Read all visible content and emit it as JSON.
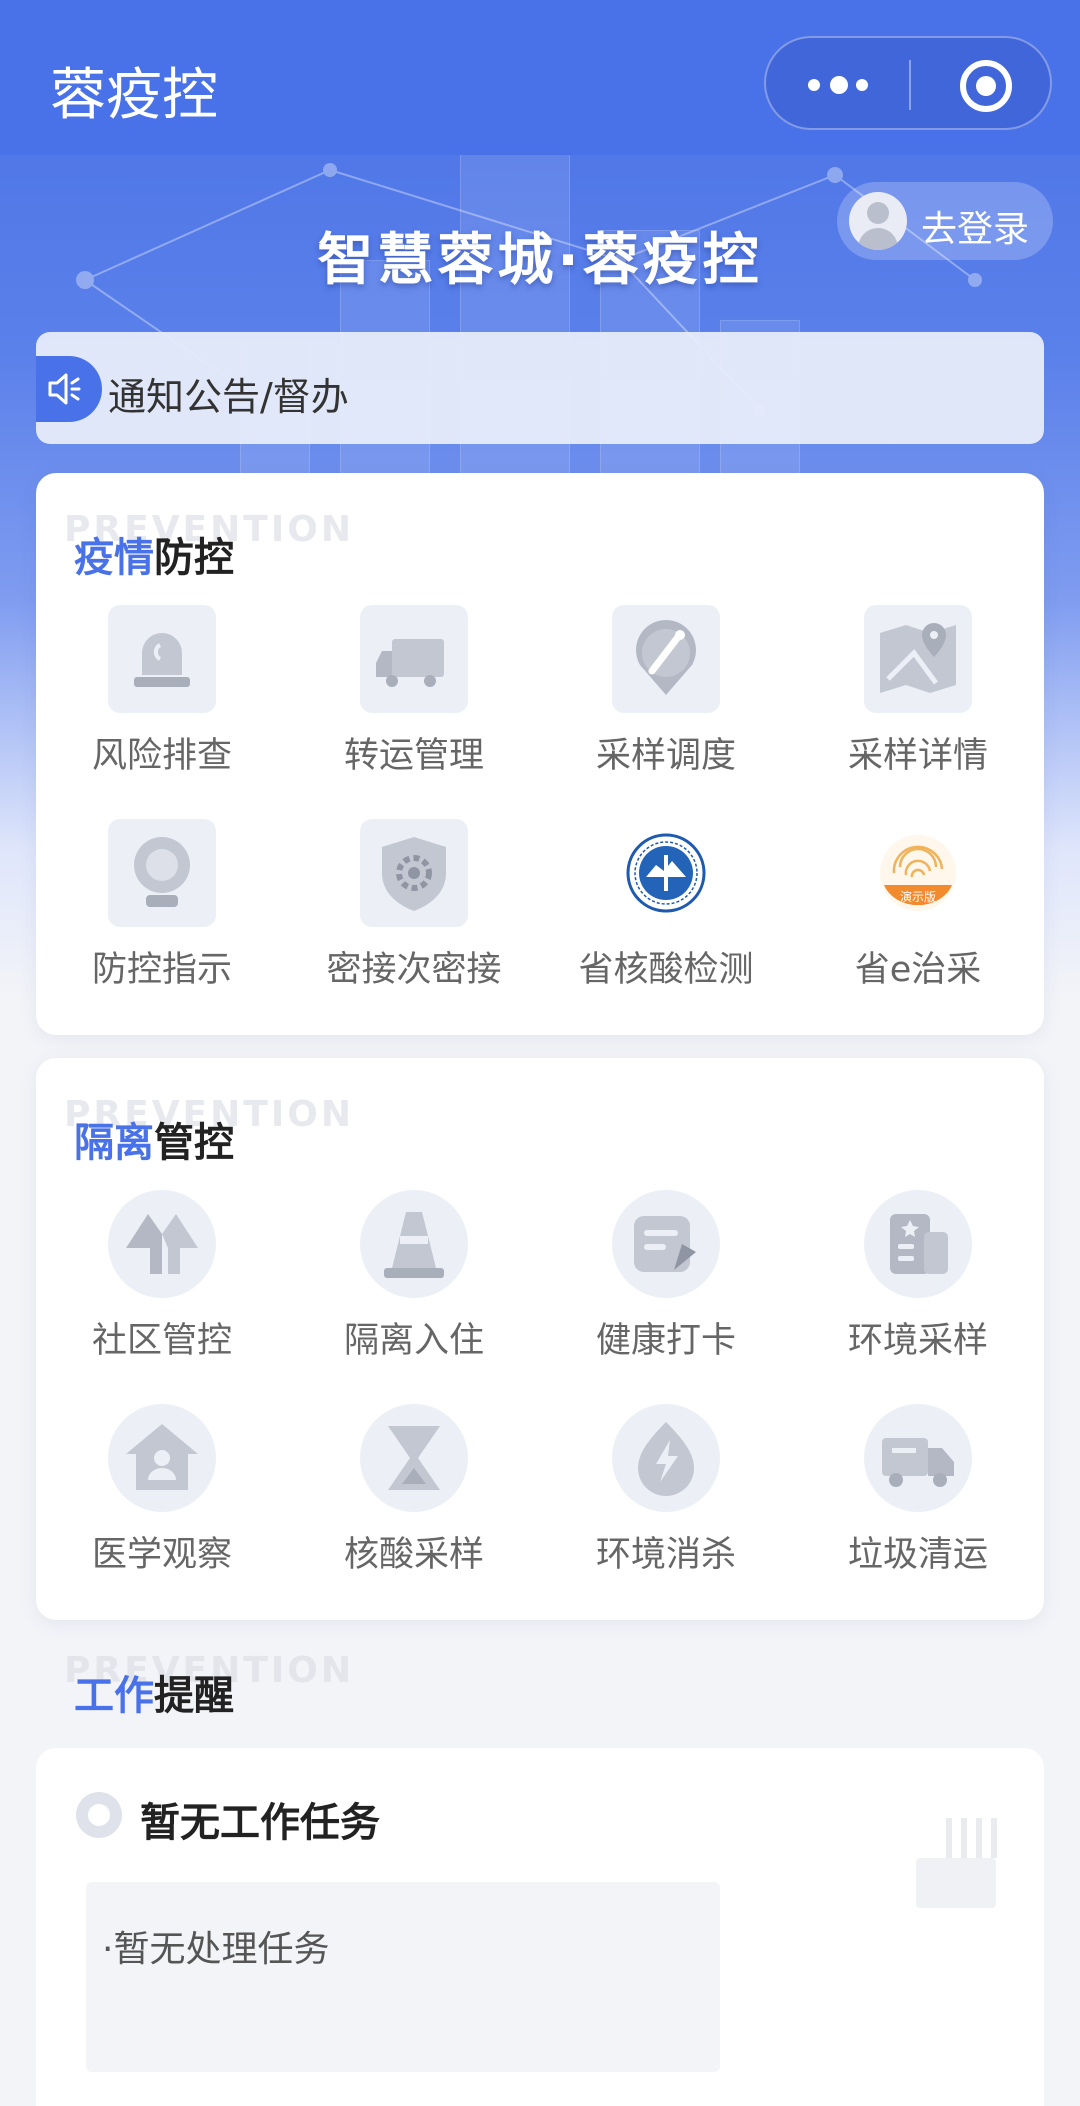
{
  "nav": {
    "title": "蓉疫控"
  },
  "hero": {
    "title": "智慧蓉城·蓉疫控",
    "login_label": "去登录"
  },
  "notice": {
    "text": "通知公告/督办"
  },
  "epidemic": {
    "bg_word": "PREVENTION",
    "title_highlight": "疫情",
    "title_rest": "防控",
    "items": [
      {
        "label": "风险排查",
        "icon": "alarm-light-icon"
      },
      {
        "label": "转运管理",
        "icon": "truck-icon"
      },
      {
        "label": "采样调度",
        "icon": "swab-pin-icon"
      },
      {
        "label": "采样详情",
        "icon": "map-pin-icon"
      },
      {
        "label": "防控指示",
        "icon": "webcam-icon"
      },
      {
        "label": "密接次密接",
        "icon": "shield-gear-icon"
      },
      {
        "label": "省核酸检测",
        "icon": "health-commission-seal-icon"
      },
      {
        "label": "省e治采",
        "icon": "fingerprint-icon",
        "badge": "演示版"
      }
    ]
  },
  "isolation": {
    "bg_word": "PREVENTION",
    "title_highlight": "隔离",
    "title_rest": "管控",
    "items": [
      {
        "label": "社区管控",
        "icon": "arrows-up-icon"
      },
      {
        "label": "隔离入住",
        "icon": "traffic-cone-icon"
      },
      {
        "label": "健康打卡",
        "icon": "pen-card-icon"
      },
      {
        "label": "环境采样",
        "icon": "building-star-icon"
      },
      {
        "label": "医学观察",
        "icon": "home-user-icon"
      },
      {
        "label": "核酸采样",
        "icon": "hourglass-icon"
      },
      {
        "label": "环境消杀",
        "icon": "lightning-icon"
      },
      {
        "label": "垃圾清运",
        "icon": "garbage-truck-icon"
      }
    ]
  },
  "work": {
    "bg_word": "PREVENTION",
    "title_highlight": "工作",
    "title_rest": "提醒",
    "task_title": "暂无工作任务",
    "task_detail": "·暂无处理任务"
  },
  "colors": {
    "brand": "#4a72e8",
    "icon_gray": "#c3c7d2"
  }
}
